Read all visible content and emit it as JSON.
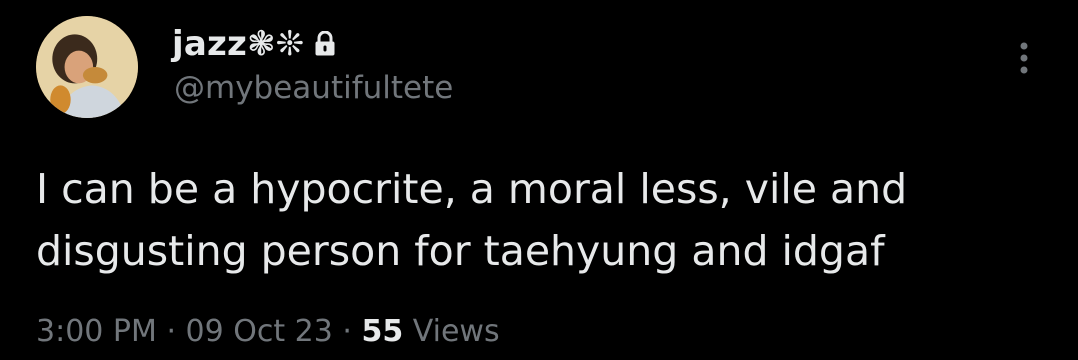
{
  "author": {
    "display_name": "jazz❃❊",
    "handle": "@mybeautifultete",
    "protected_icon": "lock-icon"
  },
  "tweet": {
    "text_line_1": "I can be a hypocrite, a moral less, vile and",
    "text_line_2": "disgusting person for taehyung and idgaf"
  },
  "meta": {
    "time": "3:00 PM",
    "separator": "·",
    "date": "09 Oct 23",
    "views_count": "55",
    "views_label": "Views"
  },
  "colors": {
    "background": "#000000",
    "primary_text": "#e7e9ea",
    "secondary_text": "#71767b"
  },
  "icons": {
    "more": "more-options-icon",
    "lock": "lock-icon"
  }
}
